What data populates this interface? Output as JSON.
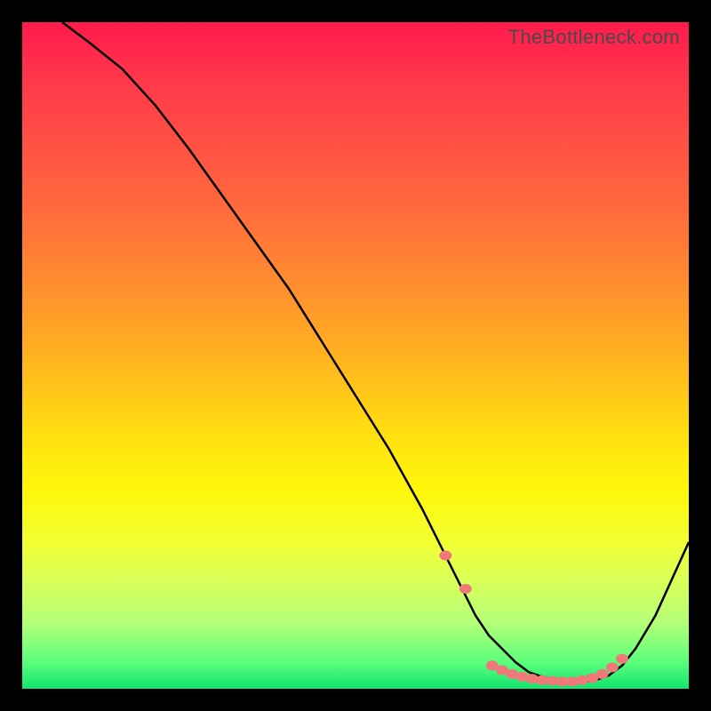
{
  "watermark": "TheBottleneck.com",
  "colors": {
    "frame": "#000000",
    "curve": "#000000",
    "marker": "#f07878",
    "gradient_top": "#ff1a4d",
    "gradient_bottom": "#10e46e"
  },
  "chart_data": {
    "type": "line",
    "title": "",
    "xlabel": "",
    "ylabel": "",
    "xlim": [
      0,
      100
    ],
    "ylim": [
      0,
      100
    ],
    "grid": false,
    "legend": false,
    "annotations": [],
    "series": [
      {
        "name": "bottleneck-curve",
        "x": [
          6,
          10,
          15,
          20,
          25,
          30,
          35,
          40,
          45,
          50,
          55,
          60,
          63,
          66,
          68,
          70,
          72,
          74,
          76,
          78,
          80,
          82,
          84,
          86,
          88,
          90,
          92,
          95,
          100
        ],
        "y": [
          100,
          97,
          93,
          87.5,
          81,
          74,
          67,
          60,
          52,
          44,
          36,
          27,
          21,
          15,
          11,
          8,
          6,
          4,
          2.5,
          1.8,
          1.3,
          1,
          1,
          1.3,
          2,
          3.5,
          6,
          11,
          22
        ]
      }
    ],
    "markers": {
      "name": "highlight-points",
      "x": [
        63.5,
        66.5,
        70.5,
        72,
        73.5,
        75,
        76.5,
        78,
        79.5,
        81,
        82.5,
        84,
        85.5,
        87,
        88.5,
        90
      ],
      "y": [
        20,
        15,
        3.5,
        2.8,
        2.2,
        1.8,
        1.5,
        1.3,
        1.2,
        1.1,
        1.1,
        1.3,
        1.6,
        2.2,
        3.2,
        4.5
      ]
    }
  }
}
